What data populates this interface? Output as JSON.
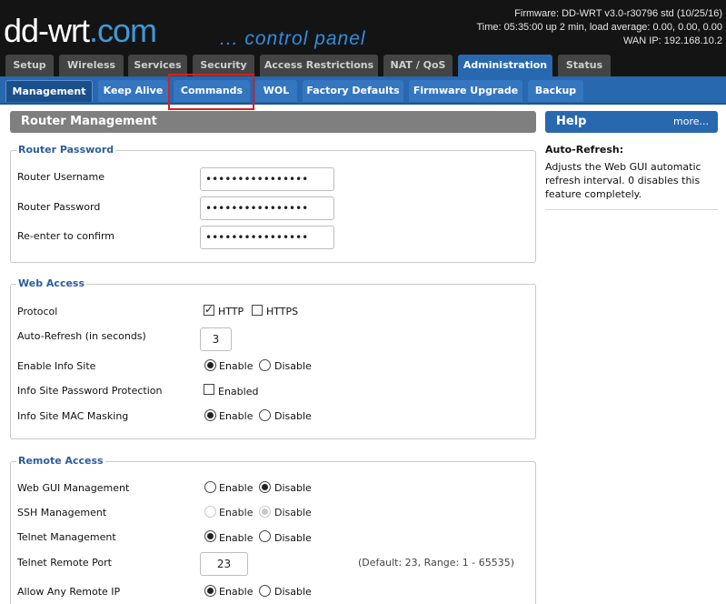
{
  "header": {
    "logo_main": "dd-wrt",
    "logo_suffix": ".com",
    "control_panel": "... control panel",
    "firmware": "Firmware: DD-WRT v3.0-r30796 std (10/25/16)",
    "time": "Time: 05:35:00 up 2 min, load average: 0.00, 0.00, 0.00",
    "wan_ip": "WAN IP: 192.168.10.2"
  },
  "main_tabs": [
    "Setup",
    "Wireless",
    "Services",
    "Security",
    "Access Restrictions",
    "NAT / QoS",
    "Administration",
    "Status"
  ],
  "sub_tabs": [
    "Management",
    "Keep Alive",
    "Commands",
    "WOL",
    "Factory Defaults",
    "Firmware Upgrade",
    "Backup"
  ],
  "section_title": "Router Management",
  "help": {
    "title": "Help",
    "more": "more...",
    "subtitle": "Auto-Refresh:",
    "text": "Adjusts the Web GUI automatic refresh interval. 0 disables this feature completely."
  },
  "router_password": {
    "legend": "Router Password",
    "username_label": "Router Username",
    "password_label": "Router Password",
    "confirm_label": "Re-enter to confirm",
    "username_value": "••••••••••••••••",
    "password_value": "••••••••••••••••",
    "confirm_value": "••••••••••••••••"
  },
  "web_access": {
    "legend": "Web Access",
    "protocol_label": "Protocol",
    "http": "HTTP",
    "https": "HTTPS",
    "autorefresh_label": "Auto-Refresh (in seconds)",
    "autorefresh_value": "3",
    "info_site_label": "Enable Info Site",
    "info_pw_label": "Info Site Password Protection",
    "info_mac_label": "Info Site MAC Masking",
    "enable": "Enable",
    "disable": "Disable",
    "enabled": "Enabled"
  },
  "remote_access": {
    "legend": "Remote Access",
    "webgui_label": "Web GUI Management",
    "ssh_label": "SSH Management",
    "telnet_label": "Telnet Management",
    "telnet_port_label": "Telnet Remote Port",
    "telnet_port_value": "23",
    "telnet_port_hint": "(Default: 23, Range: 1 - 65535)",
    "any_ip_label": "Allow Any Remote IP",
    "enable": "Enable",
    "disable": "Disable"
  },
  "colors": {
    "accent_blue": "#2868ae",
    "header_black": "#141414",
    "highlight_red": "#d91e1e"
  }
}
